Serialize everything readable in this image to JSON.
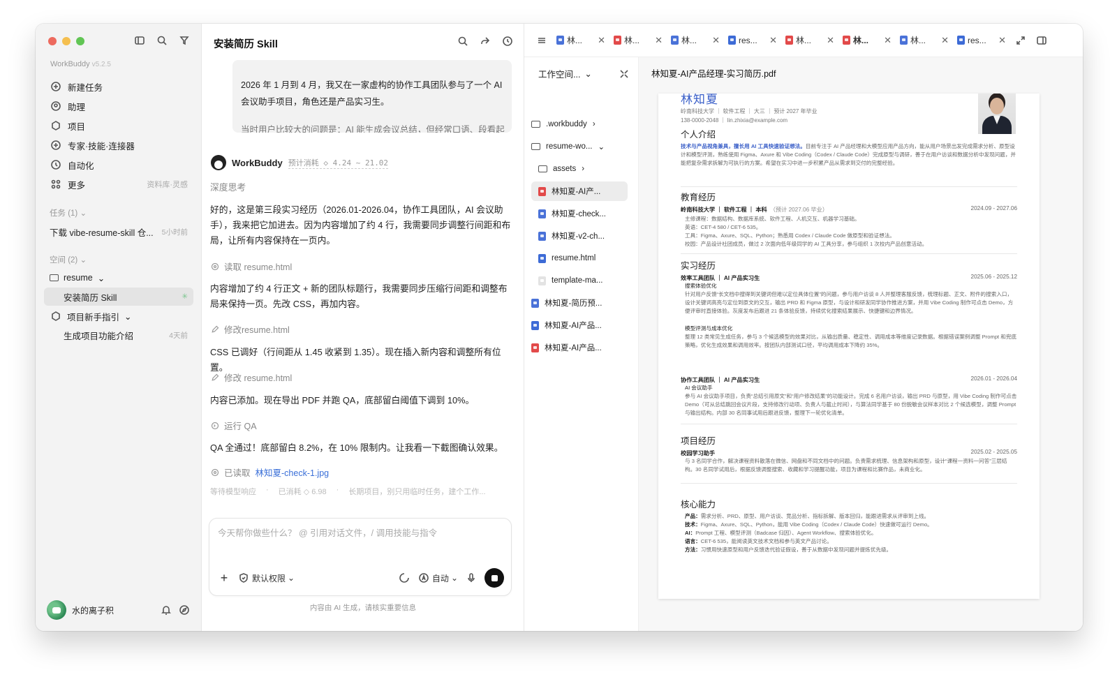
{
  "sidebar": {
    "brand": "WorkBuddy",
    "version": "v5.2.5",
    "nav": [
      {
        "label": "新建任务",
        "hint": ""
      },
      {
        "label": "助理",
        "hint": ""
      },
      {
        "label": "项目",
        "hint": ""
      },
      {
        "label": "专家·技能·连接器",
        "hint": ""
      },
      {
        "label": "自动化",
        "hint": ""
      },
      {
        "label": "更多",
        "hint": "资料库·灵感"
      }
    ],
    "tasks_label": "任务 (1)",
    "task": {
      "title": "下载 vibe-resume-skill 仓...",
      "time": "5小时前"
    },
    "spaces_label": "空间 (2)",
    "spaces": [
      {
        "label": "resume",
        "time": ""
      },
      {
        "label": "安装简历 Skill",
        "time": ""
      },
      {
        "label": "项目新手指引",
        "time": ""
      },
      {
        "label": "生成项目功能介绍",
        "time": "4天前"
      }
    ],
    "user_name": "水的离子积"
  },
  "chat": {
    "title": "安装简历 Skill",
    "quote_text": "2026 年 1 月到 4 月，我又在一家虚构的协作工具团队参与了一个 AI 会议助手项目，角色还是产品实习生。",
    "quote_faded": "当时用户比较大的问题是：AI 能生成会议总结，但经常口语、段看起",
    "agent_name": "WorkBuddy",
    "agent_cost": "预计消耗 ◇ 4.24 ~ 21.02",
    "thinking": "深度思考",
    "msg1": "好的，这是第三段实习经历（2026.01-2026.04，协作工具团队，AI 会议助手），我来把它加进去。因为内容增加了约 4 行，我需要同步调整行间距和布局，让所有内容保持在一页内。",
    "step1": "读取 resume.html",
    "msg2": "内容增加了约 4 行正文 + 新的团队标题行，我需要同步压缩行间距和调整布局来保持一页。先改 CSS，再加内容。",
    "step2": "修改resume.html",
    "msg3": "CSS 已调好（行间距从 1.45 收紧到 1.35）。现在插入新内容和调整所有位置。",
    "step3": "修改 resume.html",
    "msg4": "内容已添加。现在导出 PDF 并跑 QA，底部留白阈值下调到 10%。",
    "step4": "运行 QA",
    "msg5": "QA 全通过！底部留白 8.2%，在 10% 限制内。让我看一下截图确认效果。",
    "step5_prefix": "已读取",
    "step5_link": "林知夏-check-1.jpg",
    "status_wait": "等待模型响应",
    "status_cost": "已消耗 ◇ 6.98",
    "status_note": "长期项目，别只用临时任务，建个工作...",
    "composer_placeholder": "今天帮你做些什么？ @ 引用对话文件，/ 调用技能与指令",
    "perm_label": "默认权限",
    "mode_label": "自动",
    "disclaimer": "内容由 AI 生成，请核实重要信息"
  },
  "tabs": [
    {
      "label": "林...",
      "type": "img"
    },
    {
      "label": "林...",
      "type": "pdf"
    },
    {
      "label": "林...",
      "type": "img"
    },
    {
      "label": "res...",
      "type": "html"
    },
    {
      "label": "林...",
      "type": "pdf"
    },
    {
      "label": "林...",
      "type": "pdf"
    },
    {
      "label": "林...",
      "type": "img"
    },
    {
      "label": "res...",
      "type": "html"
    }
  ],
  "tree": {
    "workspace_label": "工作空间...",
    "rows": [
      {
        "label": ".workbuddy",
        "type": "folder",
        "suffix": "›"
      },
      {
        "label": "resume-wo...",
        "type": "folder",
        "suffix": "⌄"
      },
      {
        "label": "assets",
        "type": "folder",
        "suffix": "›"
      },
      {
        "label": "林知夏-AI产...",
        "type": "pdf",
        "suffix": ""
      },
      {
        "label": "林知夏-check...",
        "type": "img",
        "suffix": ""
      },
      {
        "label": "林知夏-v2-ch...",
        "type": "img",
        "suffix": ""
      },
      {
        "label": "resume.html",
        "type": "html",
        "suffix": ""
      },
      {
        "label": "template-ma...",
        "type": "doc",
        "suffix": ""
      },
      {
        "label": "林知夏-简历预...",
        "type": "img",
        "suffix": ""
      },
      {
        "label": "林知夏-AI产品...",
        "type": "html",
        "suffix": ""
      },
      {
        "label": "林知夏-AI产品...",
        "type": "pdf",
        "suffix": ""
      }
    ]
  },
  "preview": {
    "title": "林知夏-AI产品经理-实习简历.pdf",
    "name": "林知夏",
    "meta1": "岭南科技大学 ｜ 软件工程 ｜ 大三 ｜ 预计 2027 年毕业",
    "meta2": "138-0000-2048 ｜ lin.zhixia@example.com",
    "h_intro": "个人介绍",
    "intro_bold": "技术与产品视角兼具，擅长用 AI 工具快速验证想法。",
    "intro": "目前专注于 AI 产品经理和大模型应用产品方向，能从用户场景出发完成需求分析、原型设计和模型评测，熟练使用 Figma、Axure 和 Vibe Coding（Codex / Claude Code）完成原型与调研，善于在用户访谈和数据分析中发现问题，并能把复杂需求拆解为可执行的方案。希望在实习中进一步积累产品从需求到交付的完整经验。",
    "h_edu": "教育经历",
    "edu_school": "岭南科技大学 ｜ 软件工程 ｜ 本科",
    "edu_note": "（预计 2027.06 毕业）",
    "edu_date": "2024.09 - 2027.06",
    "edu_lines": [
      "主修课程：数据结构、数据库系统、软件工程、人机交互、机器学习基础。",
      "英语：CET-4 580 / CET-6 535。",
      "工具：Figma、Axure、SQL、Python；熟悉用 Codex / Claude Code 做原型和验证想法。",
      "校园：产品设计社团成员，做过 2 次面向低年级同学的 AI 工具分享，参与组织 1 次校内产品创意活动。"
    ],
    "h_intern": "实习经历",
    "job1_title": "效率工具团队 ｜ AI 产品实习生",
    "job1_date": "2025.06 - 2025.12",
    "job1_sub1": "搜索体验优化",
    "job1_text1": "针对用户反馈“长文档中搜得到关键词但难以定位具体位置”的问题，参与用户访谈 8 人并整理客服反馈，梳理标题、正文、附件的搜索入口，设计关键词高亮与定位到原文的交互，输出 PRD 和 Figma 原型，与设计和研发同学协作推进方案，并用 Vibe Coding 制作可点击 Demo，方便评审时直接体验。灰度发布后跟进 21 条体验反馈，持续优化搜索结果展示、快捷键和边界情况。",
    "job1_sub2": "模型评测与成本优化",
    "job1_text2": "整理 12 类常见生成任务，参与 3 个候选模型的效果对比，从输出质量、稳定性、调用成本等维度记录数据。根据错误案例调整 Prompt 和兜底策略，优化生成效果和调用效率。按团队内部测试口径，平均调用成本下降约 35%。",
    "job2_title": "协作工具团队 ｜ AI 产品实习生",
    "job2_date": "2026.01 - 2026.04",
    "job2_sub": "AI 会议助手",
    "job2_text": "参与 AI 会议助手项目，负责“总结引用原文”和“用户修改结果”的功能设计。完成 6 名用户访谈，输出 PRD 与原型，用 Vibe Coding 制作可点击 Demo（可从总结跳回会议片段，支持修改行动项、负责人与截止时间），与算法同学基于 80 份脱敏会议样本对比 2 个候选模型，调整 Prompt 与输出结构。内部 30 名同事试用后跟进反馈，整理下一轮优化清单。",
    "h_proj": "项目经历",
    "proj_title": "校园学习助手",
    "proj_date": "2025.02 - 2025.05",
    "proj_text": "与 3 名同学合作，解决课程资料散落在微信、网盘和不同文档中的问题。负责需求梳理、信息架构和原型，设计“课程一资料一问答”三层结构。30 名同学试用后，根据反馈调整搜索、收藏和学习提醒功能，项目为课程和比赛作品，未商业化。",
    "h_skill": "核心能力",
    "skills": [
      {
        "k": "产品：",
        "v": "需求分析、PRD、原型、用户访谈、竞品分析、指标拆解、版本回归，能跟进需求从评审到上线。"
      },
      {
        "k": "技术：",
        "v": "Figma、Axure、SQL、Python，能用 Vibe Coding（Codex / Claude Code）快速做可运行 Demo。"
      },
      {
        "k": "AI：",
        "v": "Prompt 工程、模型评测（Badcase 归因）、Agent Workflow、搜索体验优化。"
      },
      {
        "k": "语言：",
        "v": "CET-6 535，能阅读英文技术文档和参与英文产品讨论。"
      },
      {
        "k": "方法：",
        "v": "习惯用快速原型和用户反馈迭代验证假设，善于从数据中发现问题并提炼优先级。"
      }
    ]
  },
  "colors": {
    "accent": "#3a6fd8",
    "red": "#ed6a5e",
    "yellow": "#f5bf4f",
    "green": "#61c554"
  }
}
